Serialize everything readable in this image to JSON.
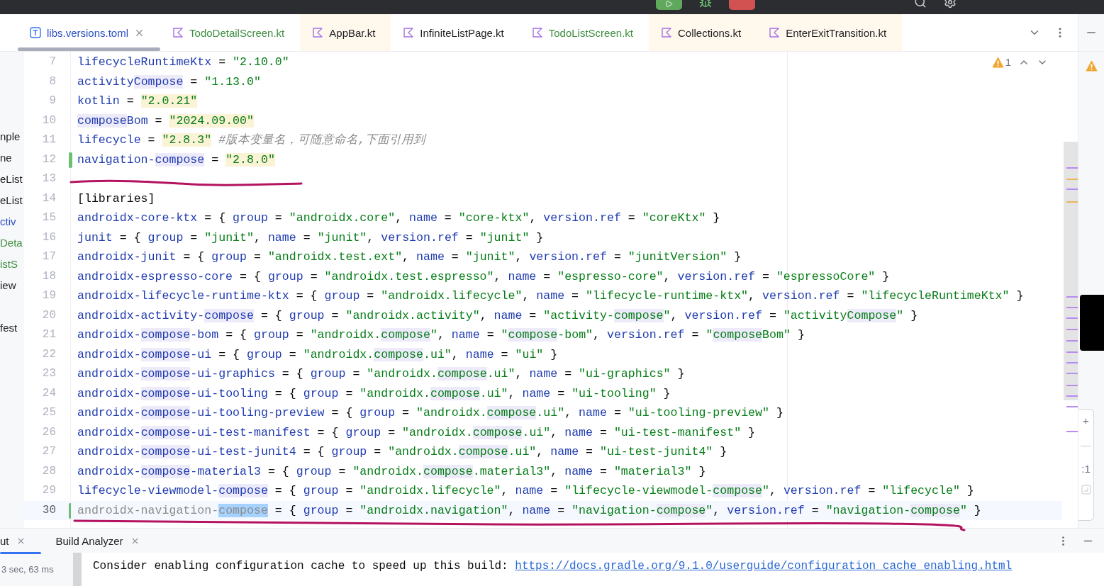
{
  "tabs": [
    {
      "label": "libs.versions.toml",
      "kind": "toml",
      "selected": true,
      "tinted": false,
      "color": "#2a4fc4"
    },
    {
      "label": "TodoDetailScreen.kt",
      "kind": "kotlin",
      "selected": false,
      "tinted": false,
      "color": "#3f8f3f"
    },
    {
      "label": "AppBar.kt",
      "kind": "kotlin",
      "selected": false,
      "tinted": true,
      "color": "#1e1f22"
    },
    {
      "label": "InfiniteListPage.kt",
      "kind": "kotlin",
      "selected": false,
      "tinted": false,
      "color": "#1e1f22"
    },
    {
      "label": "TodoListScreen.kt",
      "kind": "kotlin",
      "selected": false,
      "tinted": false,
      "color": "#3f8f3f"
    },
    {
      "label": "Collections.kt",
      "kind": "kotlin",
      "selected": false,
      "tinted": true,
      "color": "#1e1f22"
    },
    {
      "label": "EnterExitTransition.kt",
      "kind": "kotlin",
      "selected": false,
      "tinted": true,
      "color": "#1e1f22"
    }
  ],
  "sidebar": {
    "items": [
      {
        "label": "nple",
        "color": "#1e1f22"
      },
      {
        "label": "ne",
        "color": "#1e1f22"
      },
      {
        "label": "eList",
        "color": "#1e1f22"
      },
      {
        "label": "eList",
        "color": "#1e1f22"
      },
      {
        "label": "ctiv",
        "color": "#2a4fc4"
      },
      {
        "label": "Deta",
        "color": "#3f8f3f"
      },
      {
        "label": "istS",
        "color": "#3f8f3f"
      },
      {
        "label": "iew",
        "color": "#1e1f22"
      },
      {
        "label": "fest",
        "color": "#1e1f22"
      }
    ]
  },
  "editor": {
    "problems": {
      "count": "1"
    },
    "lines": [
      {
        "number": "7",
        "changed": false,
        "current": false,
        "tokens": [
          {
            "text": "lifecycleRuntimeKtx",
            "kind": "key"
          },
          {
            "text": " = ",
            "kind": "plain"
          },
          {
            "text": "\"2.10.0\"",
            "kind": "string"
          }
        ]
      },
      {
        "number": "8",
        "changed": false,
        "current": false,
        "tokens": [
          {
            "text": "activity",
            "kind": "key"
          },
          {
            "text": "Compose",
            "kind": "key-match"
          },
          {
            "text": " = ",
            "kind": "plain"
          },
          {
            "text": "\"1.13.0\"",
            "kind": "string"
          }
        ]
      },
      {
        "number": "9",
        "changed": false,
        "current": false,
        "tokens": [
          {
            "text": "kotlin",
            "kind": "key"
          },
          {
            "text": " = ",
            "kind": "plain"
          },
          {
            "text": "\"2.0.21\"",
            "kind": "marked-string"
          }
        ]
      },
      {
        "number": "10",
        "changed": false,
        "current": false,
        "tokens": [
          {
            "text": "compose",
            "kind": "key-match"
          },
          {
            "text": "Bom",
            "kind": "key"
          },
          {
            "text": " = ",
            "kind": "plain"
          },
          {
            "text": "\"2024.09.00\"",
            "kind": "marked-string"
          }
        ]
      },
      {
        "number": "11",
        "changed": false,
        "current": false,
        "tokens": [
          {
            "text": "lifecycle",
            "kind": "key"
          },
          {
            "text": " = ",
            "kind": "plain"
          },
          {
            "text": "\"2.8.3\"",
            "kind": "marked-string"
          },
          {
            "text": " #版本变量名，可随意命名,下面引用到",
            "kind": "comment"
          }
        ]
      },
      {
        "number": "12",
        "changed": true,
        "current": false,
        "tokens": [
          {
            "text": "navigation-",
            "kind": "key"
          },
          {
            "text": "compose",
            "kind": "key-match"
          },
          {
            "text": " = ",
            "kind": "plain"
          },
          {
            "text": "\"2.8.0\"",
            "kind": "marked-string"
          }
        ]
      },
      {
        "number": "13",
        "changed": false,
        "current": false
      },
      {
        "number": "14",
        "changed": false,
        "current": false,
        "tokens": [
          {
            "text": "[libraries]",
            "kind": "plain"
          }
        ]
      },
      {
        "number": "15",
        "changed": false,
        "current": false,
        "tokens": [
          {
            "text": "androidx-core-ktx",
            "kind": "key"
          },
          {
            "text": " = { ",
            "kind": "plain"
          },
          {
            "text": "group",
            "kind": "key"
          },
          {
            "text": " = ",
            "kind": "plain"
          },
          {
            "text": "\"androidx.core\"",
            "kind": "string"
          },
          {
            "text": ", ",
            "kind": "plain"
          },
          {
            "text": "name",
            "kind": "key"
          },
          {
            "text": " = ",
            "kind": "plain"
          },
          {
            "text": "\"core-ktx\"",
            "kind": "string"
          },
          {
            "text": ", ",
            "kind": "plain"
          },
          {
            "text": "version.ref",
            "kind": "key"
          },
          {
            "text": " = ",
            "kind": "plain"
          },
          {
            "text": "\"coreKtx\"",
            "kind": "string"
          },
          {
            "text": " }",
            "kind": "plain"
          }
        ]
      },
      {
        "number": "16",
        "changed": false,
        "current": false,
        "tokens": [
          {
            "text": "junit",
            "kind": "key"
          },
          {
            "text": " = { ",
            "kind": "plain"
          },
          {
            "text": "group",
            "kind": "key"
          },
          {
            "text": " = ",
            "kind": "plain"
          },
          {
            "text": "\"junit\"",
            "kind": "string"
          },
          {
            "text": ", ",
            "kind": "plain"
          },
          {
            "text": "name",
            "kind": "key"
          },
          {
            "text": " = ",
            "kind": "plain"
          },
          {
            "text": "\"junit\"",
            "kind": "string"
          },
          {
            "text": ", ",
            "kind": "plain"
          },
          {
            "text": "version.ref",
            "kind": "key"
          },
          {
            "text": " = ",
            "kind": "plain"
          },
          {
            "text": "\"junit\"",
            "kind": "string"
          },
          {
            "text": " }",
            "kind": "plain"
          }
        ]
      },
      {
        "number": "17",
        "changed": false,
        "current": false,
        "tokens": [
          {
            "text": "androidx-junit",
            "kind": "key"
          },
          {
            "text": " = { ",
            "kind": "plain"
          },
          {
            "text": "group",
            "kind": "key"
          },
          {
            "text": " = ",
            "kind": "plain"
          },
          {
            "text": "\"androidx.test.ext\"",
            "kind": "string"
          },
          {
            "text": ", ",
            "kind": "plain"
          },
          {
            "text": "name",
            "kind": "key"
          },
          {
            "text": " = ",
            "kind": "plain"
          },
          {
            "text": "\"junit\"",
            "kind": "string"
          },
          {
            "text": ", ",
            "kind": "plain"
          },
          {
            "text": "version.ref",
            "kind": "key"
          },
          {
            "text": " = ",
            "kind": "plain"
          },
          {
            "text": "\"junitVersion\"",
            "kind": "string"
          },
          {
            "text": " }",
            "kind": "plain"
          }
        ]
      },
      {
        "number": "18",
        "changed": false,
        "current": false,
        "tokens": [
          {
            "text": "androidx-espresso-core",
            "kind": "key"
          },
          {
            "text": " = { ",
            "kind": "plain"
          },
          {
            "text": "group",
            "kind": "key"
          },
          {
            "text": " = ",
            "kind": "plain"
          },
          {
            "text": "\"androidx.test.espresso\"",
            "kind": "string"
          },
          {
            "text": ", ",
            "kind": "plain"
          },
          {
            "text": "name",
            "kind": "key"
          },
          {
            "text": " = ",
            "kind": "plain"
          },
          {
            "text": "\"espresso-core\"",
            "kind": "string"
          },
          {
            "text": ", ",
            "kind": "plain"
          },
          {
            "text": "version.ref",
            "kind": "key"
          },
          {
            "text": " = ",
            "kind": "plain"
          },
          {
            "text": "\"espressoCore\"",
            "kind": "string"
          },
          {
            "text": " }",
            "kind": "plain"
          }
        ]
      },
      {
        "number": "19",
        "changed": false,
        "current": false,
        "tokens": [
          {
            "text": "androidx-lifecycle-runtime-ktx",
            "kind": "key"
          },
          {
            "text": " = { ",
            "kind": "plain"
          },
          {
            "text": "group",
            "kind": "key"
          },
          {
            "text": " = ",
            "kind": "plain"
          },
          {
            "text": "\"androidx.lifecycle\"",
            "kind": "string"
          },
          {
            "text": ", ",
            "kind": "plain"
          },
          {
            "text": "name",
            "kind": "key"
          },
          {
            "text": " = ",
            "kind": "plain"
          },
          {
            "text": "\"lifecycle-runtime-ktx\"",
            "kind": "string"
          },
          {
            "text": ", ",
            "kind": "plain"
          },
          {
            "text": "version.ref",
            "kind": "key"
          },
          {
            "text": " = ",
            "kind": "plain"
          },
          {
            "text": "\"lifecycleRuntimeKtx\"",
            "kind": "string"
          },
          {
            "text": " }",
            "kind": "plain"
          }
        ]
      },
      {
        "number": "20",
        "changed": false,
        "current": false,
        "tokens": [
          {
            "text": "androidx-activity-",
            "kind": "key"
          },
          {
            "text": "compose",
            "kind": "key-match"
          },
          {
            "text": " = { ",
            "kind": "plain"
          },
          {
            "text": "group",
            "kind": "key"
          },
          {
            "text": " = ",
            "kind": "plain"
          },
          {
            "text": "\"androidx.activity\"",
            "kind": "string"
          },
          {
            "text": ", ",
            "kind": "plain"
          },
          {
            "text": "name",
            "kind": "key"
          },
          {
            "text": " = ",
            "kind": "plain"
          },
          {
            "text": "\"activity-",
            "kind": "string"
          },
          {
            "text": "compose",
            "kind": "string-match"
          },
          {
            "text": "\"",
            "kind": "string"
          },
          {
            "text": ", ",
            "kind": "plain"
          },
          {
            "text": "version.ref",
            "kind": "key"
          },
          {
            "text": " = ",
            "kind": "plain"
          },
          {
            "text": "\"activity",
            "kind": "string"
          },
          {
            "text": "Compose",
            "kind": "string-match"
          },
          {
            "text": "\"",
            "kind": "string"
          },
          {
            "text": " }",
            "kind": "plain"
          }
        ]
      },
      {
        "number": "21",
        "changed": false,
        "current": false,
        "tokens": [
          {
            "text": "androidx-",
            "kind": "key"
          },
          {
            "text": "compose",
            "kind": "key-match"
          },
          {
            "text": "-bom",
            "kind": "key"
          },
          {
            "text": " = { ",
            "kind": "plain"
          },
          {
            "text": "group",
            "kind": "key"
          },
          {
            "text": " = ",
            "kind": "plain"
          },
          {
            "text": "\"androidx.",
            "kind": "string"
          },
          {
            "text": "compose",
            "kind": "string-match"
          },
          {
            "text": "\"",
            "kind": "string"
          },
          {
            "text": ", ",
            "kind": "plain"
          },
          {
            "text": "name",
            "kind": "key"
          },
          {
            "text": " = ",
            "kind": "plain"
          },
          {
            "text": "\"",
            "kind": "string"
          },
          {
            "text": "compose",
            "kind": "string-match"
          },
          {
            "text": "-bom\"",
            "kind": "string"
          },
          {
            "text": ", ",
            "kind": "plain"
          },
          {
            "text": "version.ref",
            "kind": "key"
          },
          {
            "text": " = ",
            "kind": "plain"
          },
          {
            "text": "\"",
            "kind": "string"
          },
          {
            "text": "compose",
            "kind": "string-match"
          },
          {
            "text": "Bom\"",
            "kind": "string"
          },
          {
            "text": " }",
            "kind": "plain"
          }
        ]
      },
      {
        "number": "22",
        "changed": false,
        "current": false,
        "tokens": [
          {
            "text": "androidx-",
            "kind": "key"
          },
          {
            "text": "compose",
            "kind": "key-match"
          },
          {
            "text": "-ui",
            "kind": "key"
          },
          {
            "text": " = { ",
            "kind": "plain"
          },
          {
            "text": "group",
            "kind": "key"
          },
          {
            "text": " = ",
            "kind": "plain"
          },
          {
            "text": "\"androidx.",
            "kind": "string"
          },
          {
            "text": "compose",
            "kind": "string-match"
          },
          {
            "text": ".ui\"",
            "kind": "string"
          },
          {
            "text": ", ",
            "kind": "plain"
          },
          {
            "text": "name",
            "kind": "key"
          },
          {
            "text": " = ",
            "kind": "plain"
          },
          {
            "text": "\"ui\"",
            "kind": "string"
          },
          {
            "text": " }",
            "kind": "plain"
          }
        ]
      },
      {
        "number": "23",
        "changed": false,
        "current": false,
        "tokens": [
          {
            "text": "androidx-",
            "kind": "key"
          },
          {
            "text": "compose",
            "kind": "key-match"
          },
          {
            "text": "-ui-graphics",
            "kind": "key"
          },
          {
            "text": " = { ",
            "kind": "plain"
          },
          {
            "text": "group",
            "kind": "key"
          },
          {
            "text": " = ",
            "kind": "plain"
          },
          {
            "text": "\"androidx.",
            "kind": "string"
          },
          {
            "text": "compose",
            "kind": "string-match"
          },
          {
            "text": ".ui\"",
            "kind": "string"
          },
          {
            "text": ", ",
            "kind": "plain"
          },
          {
            "text": "name",
            "kind": "key"
          },
          {
            "text": " = ",
            "kind": "plain"
          },
          {
            "text": "\"ui-graphics\"",
            "kind": "string"
          },
          {
            "text": " }",
            "kind": "plain"
          }
        ]
      },
      {
        "number": "24",
        "changed": false,
        "current": false,
        "tokens": [
          {
            "text": "androidx-",
            "kind": "key"
          },
          {
            "text": "compose",
            "kind": "key-match"
          },
          {
            "text": "-ui-tooling",
            "kind": "key"
          },
          {
            "text": " = { ",
            "kind": "plain"
          },
          {
            "text": "group",
            "kind": "key"
          },
          {
            "text": " = ",
            "kind": "plain"
          },
          {
            "text": "\"androidx.",
            "kind": "string"
          },
          {
            "text": "compose",
            "kind": "string-match"
          },
          {
            "text": ".ui\"",
            "kind": "string"
          },
          {
            "text": ", ",
            "kind": "plain"
          },
          {
            "text": "name",
            "kind": "key"
          },
          {
            "text": " = ",
            "kind": "plain"
          },
          {
            "text": "\"ui-tooling\"",
            "kind": "string"
          },
          {
            "text": " }",
            "kind": "plain"
          }
        ]
      },
      {
        "number": "25",
        "changed": false,
        "current": false,
        "tokens": [
          {
            "text": "androidx-",
            "kind": "key"
          },
          {
            "text": "compose",
            "kind": "key-match"
          },
          {
            "text": "-ui-tooling-preview",
            "kind": "key"
          },
          {
            "text": " = { ",
            "kind": "plain"
          },
          {
            "text": "group",
            "kind": "key"
          },
          {
            "text": " = ",
            "kind": "plain"
          },
          {
            "text": "\"androidx.",
            "kind": "string"
          },
          {
            "text": "compose",
            "kind": "string-match"
          },
          {
            "text": ".ui\"",
            "kind": "string"
          },
          {
            "text": ", ",
            "kind": "plain"
          },
          {
            "text": "name",
            "kind": "key"
          },
          {
            "text": " = ",
            "kind": "plain"
          },
          {
            "text": "\"ui-tooling-preview\"",
            "kind": "string"
          },
          {
            "text": " }",
            "kind": "plain"
          }
        ]
      },
      {
        "number": "26",
        "changed": false,
        "current": false,
        "tokens": [
          {
            "text": "androidx-",
            "kind": "key"
          },
          {
            "text": "compose",
            "kind": "key-match"
          },
          {
            "text": "-ui-test-manifest",
            "kind": "key"
          },
          {
            "text": " = { ",
            "kind": "plain"
          },
          {
            "text": "group",
            "kind": "key"
          },
          {
            "text": " = ",
            "kind": "plain"
          },
          {
            "text": "\"androidx.",
            "kind": "string"
          },
          {
            "text": "compose",
            "kind": "string-match"
          },
          {
            "text": ".ui\"",
            "kind": "string"
          },
          {
            "text": ", ",
            "kind": "plain"
          },
          {
            "text": "name",
            "kind": "key"
          },
          {
            "text": " = ",
            "kind": "plain"
          },
          {
            "text": "\"ui-test-manifest\"",
            "kind": "string"
          },
          {
            "text": " }",
            "kind": "plain"
          }
        ]
      },
      {
        "number": "27",
        "changed": false,
        "current": false,
        "tokens": [
          {
            "text": "androidx-",
            "kind": "key"
          },
          {
            "text": "compose",
            "kind": "key-match"
          },
          {
            "text": "-ui-test-junit4",
            "kind": "key"
          },
          {
            "text": " = { ",
            "kind": "plain"
          },
          {
            "text": "group",
            "kind": "key"
          },
          {
            "text": " = ",
            "kind": "plain"
          },
          {
            "text": "\"androidx.",
            "kind": "string"
          },
          {
            "text": "compose",
            "kind": "string-match"
          },
          {
            "text": ".ui\"",
            "kind": "string"
          },
          {
            "text": ", ",
            "kind": "plain"
          },
          {
            "text": "name",
            "kind": "key"
          },
          {
            "text": " = ",
            "kind": "plain"
          },
          {
            "text": "\"ui-test-junit4\"",
            "kind": "string"
          },
          {
            "text": " }",
            "kind": "plain"
          }
        ]
      },
      {
        "number": "28",
        "changed": false,
        "current": false,
        "tokens": [
          {
            "text": "androidx-",
            "kind": "key"
          },
          {
            "text": "compose",
            "kind": "key-match"
          },
          {
            "text": "-material3",
            "kind": "key"
          },
          {
            "text": " = { ",
            "kind": "plain"
          },
          {
            "text": "group",
            "kind": "key"
          },
          {
            "text": " = ",
            "kind": "plain"
          },
          {
            "text": "\"androidx.",
            "kind": "string"
          },
          {
            "text": "compose",
            "kind": "string-match"
          },
          {
            "text": ".material3\"",
            "kind": "string"
          },
          {
            "text": ", ",
            "kind": "plain"
          },
          {
            "text": "name",
            "kind": "key"
          },
          {
            "text": " = ",
            "kind": "plain"
          },
          {
            "text": "\"material3\"",
            "kind": "string"
          },
          {
            "text": " }",
            "kind": "plain"
          }
        ]
      },
      {
        "number": "29",
        "changed": false,
        "current": false,
        "tokens": [
          {
            "text": "lifecycle-viewmodel-",
            "kind": "key"
          },
          {
            "text": "compose",
            "kind": "key-match"
          },
          {
            "text": " = { ",
            "kind": "plain"
          },
          {
            "text": "group",
            "kind": "key"
          },
          {
            "text": " = ",
            "kind": "plain"
          },
          {
            "text": "\"androidx.lifecycle\"",
            "kind": "string"
          },
          {
            "text": ", ",
            "kind": "plain"
          },
          {
            "text": "name",
            "kind": "key"
          },
          {
            "text": " = ",
            "kind": "plain"
          },
          {
            "text": "\"lifecycle-viewmodel-",
            "kind": "string"
          },
          {
            "text": "compose",
            "kind": "string-match"
          },
          {
            "text": "\"",
            "kind": "string"
          },
          {
            "text": ", ",
            "kind": "plain"
          },
          {
            "text": "version.ref",
            "kind": "key"
          },
          {
            "text": " = ",
            "kind": "plain"
          },
          {
            "text": "\"lifecycle\"",
            "kind": "string"
          },
          {
            "text": " }",
            "kind": "plain"
          }
        ]
      },
      {
        "number": "30",
        "changed": true,
        "current": true,
        "tokens": [
          {
            "text": "androidx-navigation-",
            "kind": "dim-key"
          },
          {
            "text": "compose",
            "kind": "selection"
          },
          {
            "text": " = { ",
            "kind": "plain"
          },
          {
            "text": "group",
            "kind": "key"
          },
          {
            "text": " = ",
            "kind": "plain"
          },
          {
            "text": "\"androidx.navigation\"",
            "kind": "string"
          },
          {
            "text": ", ",
            "kind": "plain"
          },
          {
            "text": "name",
            "kind": "key"
          },
          {
            "text": " = ",
            "kind": "plain"
          },
          {
            "text": "\"navigation-",
            "kind": "string"
          },
          {
            "text": "compose",
            "kind": "string-match"
          },
          {
            "text": "\"",
            "kind": "string"
          },
          {
            "text": ", ",
            "kind": "plain"
          },
          {
            "text": "version.ref",
            "kind": "key"
          },
          {
            "text": " = ",
            "kind": "plain"
          },
          {
            "text": "\"navigation-",
            "kind": "string"
          },
          {
            "text": "compose",
            "kind": "string-match"
          },
          {
            "text": "\"",
            "kind": "string"
          },
          {
            "text": " }",
            "kind": "plain"
          }
        ]
      }
    ]
  },
  "zoom_control": {
    "plus": "+",
    "minus": "—",
    "ratio": ":1"
  },
  "bottom_panel": {
    "tabs": [
      {
        "label": "ut",
        "selected": true
      },
      {
        "label": "Build Analyzer",
        "selected": false
      }
    ],
    "build_time": "3 sec, 63 ms",
    "message": "Consider enabling configuration cache to speed up this build: ",
    "link": "https://docs.gradle.org/9.1.0/userguide/configuration_cache_enabling.html"
  }
}
